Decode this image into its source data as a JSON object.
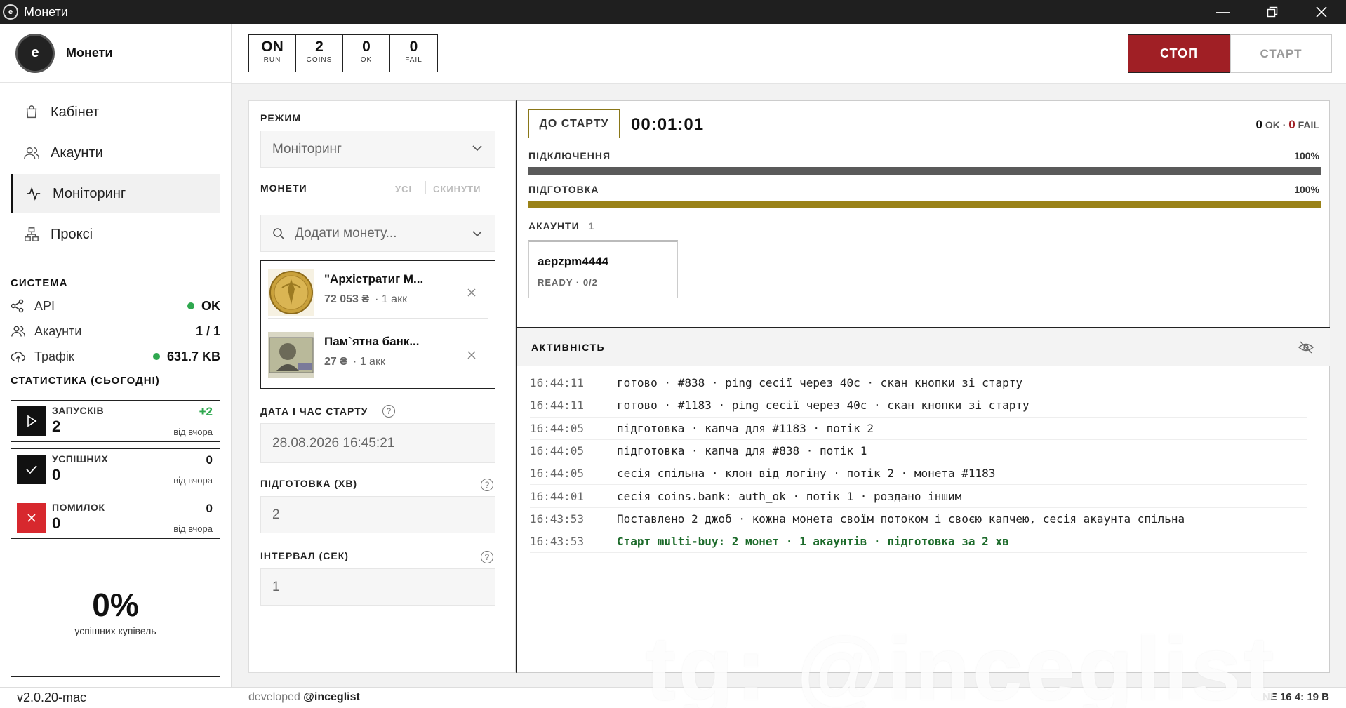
{
  "window": {
    "title": "Монети"
  },
  "brand": {
    "logo_text": "e",
    "name": "Монети"
  },
  "nav": [
    {
      "label": "Кабінет",
      "icon": "cart-icon"
    },
    {
      "label": "Акаунти",
      "icon": "users-icon"
    },
    {
      "label": "Моніторинг",
      "icon": "activity-icon",
      "active": true
    },
    {
      "label": "Проксі",
      "icon": "network-icon"
    }
  ],
  "system": {
    "title": "СИСТЕМА",
    "api": {
      "label": "API",
      "value": "OK"
    },
    "accounts": {
      "label": "Акаунти",
      "value": "1 / 1"
    },
    "traffic": {
      "label": "Трафік",
      "value": "631.7 KB"
    }
  },
  "stats": {
    "title": "СТАТИСТИКА (СЬОГОДНІ)",
    "launches": {
      "label": "ЗАПУСКІВ",
      "value": "2",
      "delta": "+2",
      "since": "від вчора"
    },
    "success": {
      "label": "УСПІШНИХ",
      "value": "0",
      "delta": "0",
      "since": "від вчора"
    },
    "errors": {
      "label": "ПОМИЛОК",
      "value": "0",
      "delta": "0",
      "since": "від вчора"
    },
    "success_rate": {
      "value": "0%",
      "label": "успішних купівель"
    }
  },
  "counters": [
    {
      "value": "ON",
      "label": "RUN"
    },
    {
      "value": "2",
      "label": "COINS"
    },
    {
      "value": "0",
      "label": "OK"
    },
    {
      "value": "0",
      "label": "FAIL"
    }
  ],
  "actions": {
    "stop": "СТОП",
    "start": "СТАРТ"
  },
  "config": {
    "mode_label": "РЕЖИМ",
    "mode_value": "Моніторинг",
    "coins_label": "МОНЕТИ",
    "coins_all": "УСІ",
    "coins_reset": "СКИНУТИ",
    "coin_search_placeholder": "Додати монету...",
    "coins": [
      {
        "name": "\"Архістратиг М...",
        "price": "72 053 ₴",
        "accounts": "· 1 акк"
      },
      {
        "name": "Пам`ятна банк...",
        "price": "27 ₴",
        "accounts": "· 1 акк"
      }
    ],
    "start_label": "ДАТА І ЧАС СТАРТУ",
    "start_value": "28.08.2026 16:45:21",
    "prep_label": "ПІДГОТОВКА (ХВ)",
    "prep_value": "2",
    "interval_label": "ІНТЕРВАЛ (СЕК)",
    "interval_value": "1"
  },
  "monitor": {
    "to_start": "ДО СТАРТУ",
    "timer": "00:01:01",
    "ok_value": "0",
    "ok_label": "OK",
    "fail_value": "0",
    "fail_label": "FAIL",
    "connection": {
      "label": "ПІДКЛЮЧЕННЯ",
      "percent": "100%",
      "fraction": 1.0,
      "color": "#5a5a5a"
    },
    "preparation": {
      "label": "ПІДГОТОВКА",
      "percent": "100%",
      "fraction": 1.0,
      "color": "#9a8218"
    },
    "accounts_label": "АКАУНТИ",
    "accounts_count": "1",
    "account": {
      "username": "aepzpm4444",
      "status": "READY · 0/2"
    }
  },
  "activity": {
    "title": "АКТИВНІСТЬ",
    "rows": [
      {
        "time": "16:44:11",
        "msg": "готово · #838 · ping сесії через 40с · скан кнопки зі старту",
        "type": "normal"
      },
      {
        "time": "16:44:11",
        "msg": "готово · #1183 · ping сесії через 40с · скан кнопки зі старту",
        "type": "normal"
      },
      {
        "time": "16:44:05",
        "msg": "підготовка · капча для #1183 · потік 2",
        "type": "normal"
      },
      {
        "time": "16:44:05",
        "msg": "підготовка · капча для #838 · потік 1",
        "type": "normal"
      },
      {
        "time": "16:44:05",
        "msg": "сесія спільна · клон від логіну · потік 2 · монета #1183",
        "type": "normal"
      },
      {
        "time": "16:44:01",
        "msg": "сесія coins.bank: auth_ok · потік 1 · роздано іншим",
        "type": "normal"
      },
      {
        "time": "16:43:53",
        "msg": "Поставлено 2 джоб · кожна монета своїм потоком і своєю капчею, сесія акаунта спільна",
        "type": "normal"
      },
      {
        "time": "16:43:53",
        "msg": "Старт multi-buy: 2 монет · 1 акаунтів · підготовка за 2 хв",
        "type": "success"
      }
    ]
  },
  "footer": {
    "version": "v2.0.20-mac",
    "developed": "developed",
    "handle": "@inceglist",
    "net": "NE  16  4:  19  B"
  },
  "watermark": "tg: @inceglist"
}
